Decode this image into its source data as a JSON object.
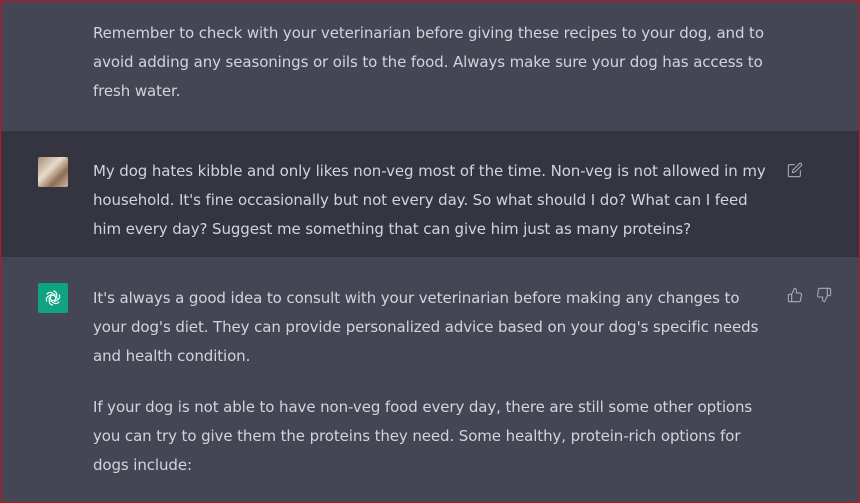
{
  "messages": [
    {
      "role": "assistant",
      "paragraphs": [
        "Remember to check with your veterinarian before giving these recipes to your dog, and to avoid adding any seasonings or oils to the food. Always make sure your dog has access to fresh water."
      ]
    },
    {
      "role": "user",
      "paragraphs": [
        "My dog hates kibble and only likes non-veg most of the time. Non-veg is not allowed in my household. It's fine occasionally but not every day. So what should I do? What can I feed him every day? Suggest me something that can give him just as many proteins?"
      ],
      "actions": [
        "edit-icon"
      ]
    },
    {
      "role": "assistant",
      "paragraphs": [
        "It's always a good idea to consult with your veterinarian before making any changes to your dog's diet. They can provide personalized advice based on your dog's specific needs and health condition.",
        "If your dog is not able to have non-veg food every day, there are still some other options you can try to give them the proteins they need. Some healthy, protein-rich options for dogs include:"
      ],
      "actions": [
        "thumbs-up-icon",
        "thumbs-down-icon"
      ]
    }
  ],
  "colors": {
    "assistant_bg": "#444654",
    "user_bg": "#343541",
    "text": "#d1d5db",
    "brand": "#10a37f",
    "frame_border": "#c0161b"
  }
}
